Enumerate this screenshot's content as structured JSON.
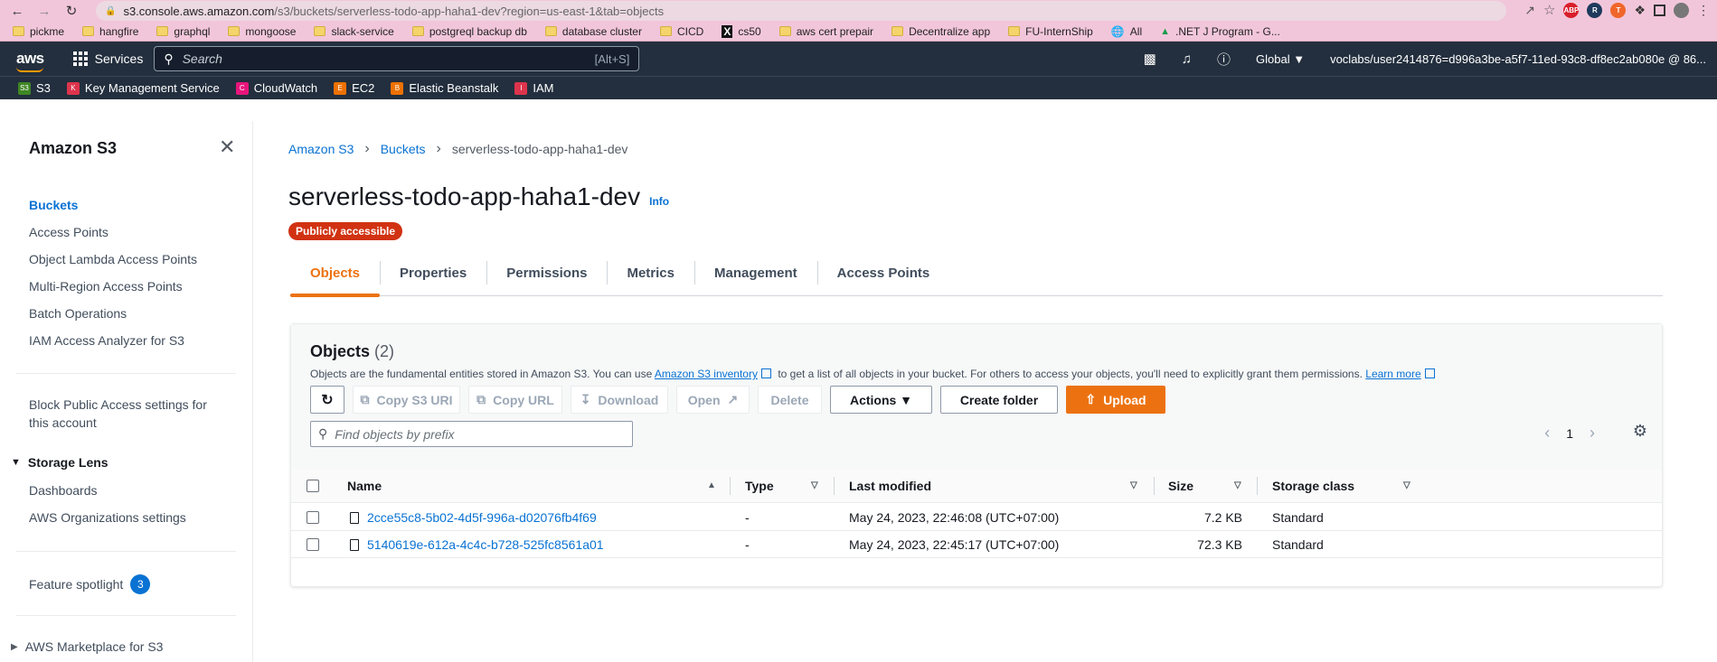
{
  "browser": {
    "url_host": "s3.console.aws.amazon.com",
    "url_path": "/s3/buckets/serverless-todo-app-haha1-dev?region=us-east-1&tab=objects",
    "bookmarks": [
      "pickme",
      "hangfire",
      "graphql",
      "mongoose",
      "slack-service",
      "postgreql backup db",
      "database cluster",
      "CICD",
      "cs50",
      "aws cert prepair",
      "Decentralize app",
      "FU-InternShip",
      "All",
      ".NET J Program - G..."
    ]
  },
  "aws_header": {
    "logo": "aws",
    "services_label": "Services",
    "search_placeholder": "Search",
    "search_shortcut": "[Alt+S]",
    "region": "Global ▼",
    "account": "voclabs/user2414876=d996a3be-a5f7-11ed-93c8-df8ec2ab080e @ 86...",
    "favorites": [
      "S3",
      "Key Management Service",
      "CloudWatch",
      "EC2",
      "Elastic Beanstalk",
      "IAM"
    ]
  },
  "sidebar": {
    "title": "Amazon S3",
    "items": [
      "Buckets",
      "Access Points",
      "Object Lambda Access Points",
      "Multi-Region Access Points",
      "Batch Operations",
      "IAM Access Analyzer for S3"
    ],
    "block_public_1": "Block Public Access settings for",
    "block_public_2": "this account",
    "storage_lens": "Storage Lens",
    "storage_items": [
      "Dashboards",
      "AWS Organizations settings"
    ],
    "feature_spotlight": "Feature spotlight",
    "feature_count": "3",
    "marketplace": "AWS Marketplace for S3"
  },
  "breadcrumb": [
    "Amazon S3",
    "Buckets",
    "serverless-todo-app-haha1-dev"
  ],
  "page": {
    "title": "serverless-todo-app-haha1-dev",
    "info": "Info",
    "badge": "Publicly accessible"
  },
  "tabs": [
    "Objects",
    "Properties",
    "Permissions",
    "Metrics",
    "Management",
    "Access Points"
  ],
  "objects_panel": {
    "title": "Objects",
    "count": "(2)",
    "desc_1": "Objects are the fundamental entities stored in Amazon S3. You can use",
    "desc_link": "Amazon S3 inventory",
    "desc_2": "to get a list of all objects in your bucket. For others to access your objects, you'll need to explicitly grant them permissions.",
    "learn_more": "Learn more",
    "buttons": {
      "copy_uri": "Copy S3 URI",
      "copy_url": "Copy URL",
      "download": "Download",
      "open": "Open",
      "delete": "Delete",
      "actions": "Actions ▼",
      "create_folder": "Create folder",
      "upload": "Upload"
    },
    "find_placeholder": "Find objects by prefix",
    "page_number": "1",
    "columns": [
      "Name",
      "Type",
      "Last modified",
      "Size",
      "Storage class"
    ],
    "rows": [
      {
        "name": "2cce55c8-5b02-4d5f-996a-d02076fb4f69",
        "type": "-",
        "modified": "May 24, 2023, 22:46:08 (UTC+07:00)",
        "size": "7.2 KB",
        "class": "Standard"
      },
      {
        "name": "5140619e-612a-4c4c-b728-525fc8561a01",
        "type": "-",
        "modified": "May 24, 2023, 22:45:17 (UTC+07:00)",
        "size": "72.3 KB",
        "class": "Standard"
      }
    ]
  }
}
